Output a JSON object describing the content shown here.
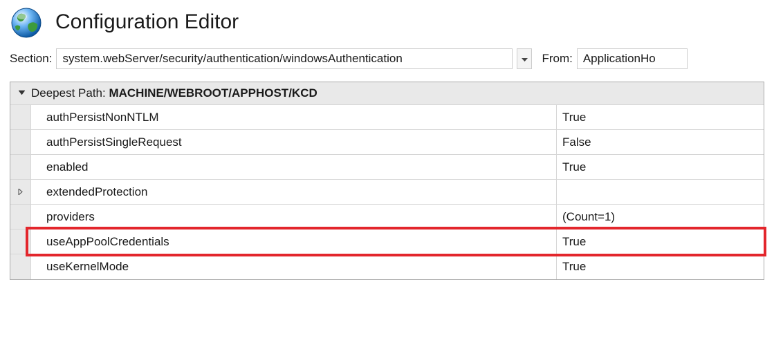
{
  "header": {
    "title": "Configuration Editor"
  },
  "section": {
    "label": "Section:",
    "value": "system.webServer/security/authentication/windowsAuthentication",
    "from_label": "From:",
    "from_value": "ApplicationHo"
  },
  "grid": {
    "header_prefix": "Deepest Path: ",
    "header_path": "MACHINE/WEBROOT/APPHOST/KCD",
    "rows": [
      {
        "label": "authPersistNonNTLM",
        "value": "True",
        "expandable": false
      },
      {
        "label": "authPersistSingleRequest",
        "value": "False",
        "expandable": false
      },
      {
        "label": "enabled",
        "value": "True",
        "expandable": false
      },
      {
        "label": "extendedProtection",
        "value": "",
        "expandable": true
      },
      {
        "label": "providers",
        "value": "(Count=1)",
        "expandable": false
      },
      {
        "label": "useAppPoolCredentials",
        "value": "True",
        "expandable": false,
        "highlighted": true
      },
      {
        "label": "useKernelMode",
        "value": "True",
        "expandable": false
      }
    ]
  }
}
